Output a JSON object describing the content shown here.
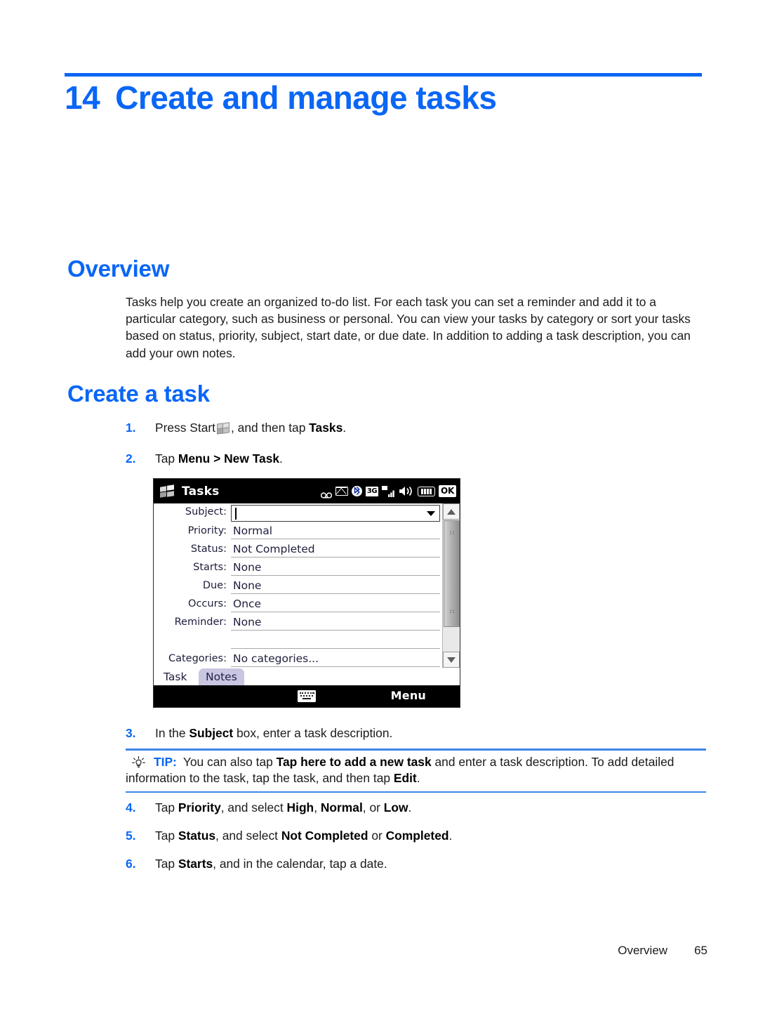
{
  "chapter": {
    "number": "14",
    "title": "Create and manage tasks",
    "rule_color": "#0a66f5",
    "title_color": "#0a66f5"
  },
  "sections": {
    "overview": {
      "heading": "Overview",
      "paragraph": "Tasks help you create an organized to-do list. For each task you can set a reminder and add it to a particular category, such as business or personal. You can view your tasks by category or sort your tasks based on status, priority, subject, start date, or due date. In addition to adding a task description, you can add your own notes."
    },
    "create_a_task": {
      "heading": "Create a task",
      "steps": [
        {
          "number": "1.",
          "text": "Press Start"
        },
        {
          "number": "2.",
          "text": "Tap "
        },
        {
          "number": "3.",
          "text": "In the "
        },
        {
          "number": "4.",
          "text": "Tap "
        },
        {
          "number": "5.",
          "text": "Tap "
        },
        {
          "number": "6.",
          "text": "Tap "
        }
      ],
      "step1_prefix": "Press Start",
      "step1_mid": ", and then tap ",
      "step1_bold": "Tasks",
      "step1_suffix": ".",
      "step2_prefix": "Tap ",
      "step2_bold": "Menu > New Task",
      "step2_suffix": ".",
      "step3_prefix": "In the ",
      "step3_bold": "Subject",
      "step3_suffix": " box, enter a task description.",
      "step4_prefix": "Tap ",
      "step4_bold1": "Priority",
      "step4_mid1": ", and select ",
      "step4_bold2": "High",
      "step4_mid2": ", ",
      "step4_bold3": "Normal",
      "step4_mid3": ", or ",
      "step4_bold4": "Low",
      "step4_suffix": ".",
      "step5_prefix": "Tap ",
      "step5_bold1": "Status",
      "step5_mid1": ", and select ",
      "step5_bold2": "Not Completed",
      "step5_mid2": " or ",
      "step5_bold3": "Completed",
      "step5_suffix": ".",
      "step6_prefix": "Tap ",
      "step6_bold1": "Starts",
      "step6_suffix": ", and in the calendar, tap a date."
    }
  },
  "tip": {
    "label": "TIP:",
    "text_prefix": "You can also tap ",
    "bold1": "Tap here to add a new task",
    "text_mid": " and enter a task description. To add detailed information to the task, tap the task, and then tap ",
    "bold2": "Edit",
    "text_suffix": ".",
    "label_color": "#0a66f5",
    "rule_color": "#3d86e8"
  },
  "device_screenshot": {
    "titlebar": {
      "app_title": "Tasks",
      "status_icons": [
        "voicemail-icon",
        "envelope-icon",
        "bluetooth-icon",
        "3g-icon",
        "signal-icon",
        "speaker-icon",
        "battery-icon",
        "ok-button"
      ],
      "bluetooth_glyph": "Ƀ",
      "network_label": "3G",
      "ok_label": "OK",
      "background": "#000000"
    },
    "form_rows": [
      {
        "label": "Subject:",
        "value": "",
        "type": "combo"
      },
      {
        "label": "Priority:",
        "value": "Normal",
        "type": "text"
      },
      {
        "label": "Status:",
        "value": "Not Completed",
        "type": "text"
      },
      {
        "label": "Starts:",
        "value": "None",
        "type": "text"
      },
      {
        "label": "Due:",
        "value": "None",
        "type": "text"
      },
      {
        "label": "Occurs:",
        "value": "Once",
        "type": "text"
      },
      {
        "label": "Reminder:",
        "value": "None",
        "type": "text"
      },
      {
        "label": "Categories:",
        "value": "No categories...",
        "type": "text"
      }
    ],
    "tabs": [
      {
        "label": "Task",
        "active": true
      },
      {
        "label": "Notes",
        "active": false
      }
    ],
    "command_bar": {
      "keyboard_icon": "keyboard-icon",
      "menu_label": "Menu"
    }
  },
  "footer": {
    "section_label": "Overview",
    "page_number": "65"
  }
}
